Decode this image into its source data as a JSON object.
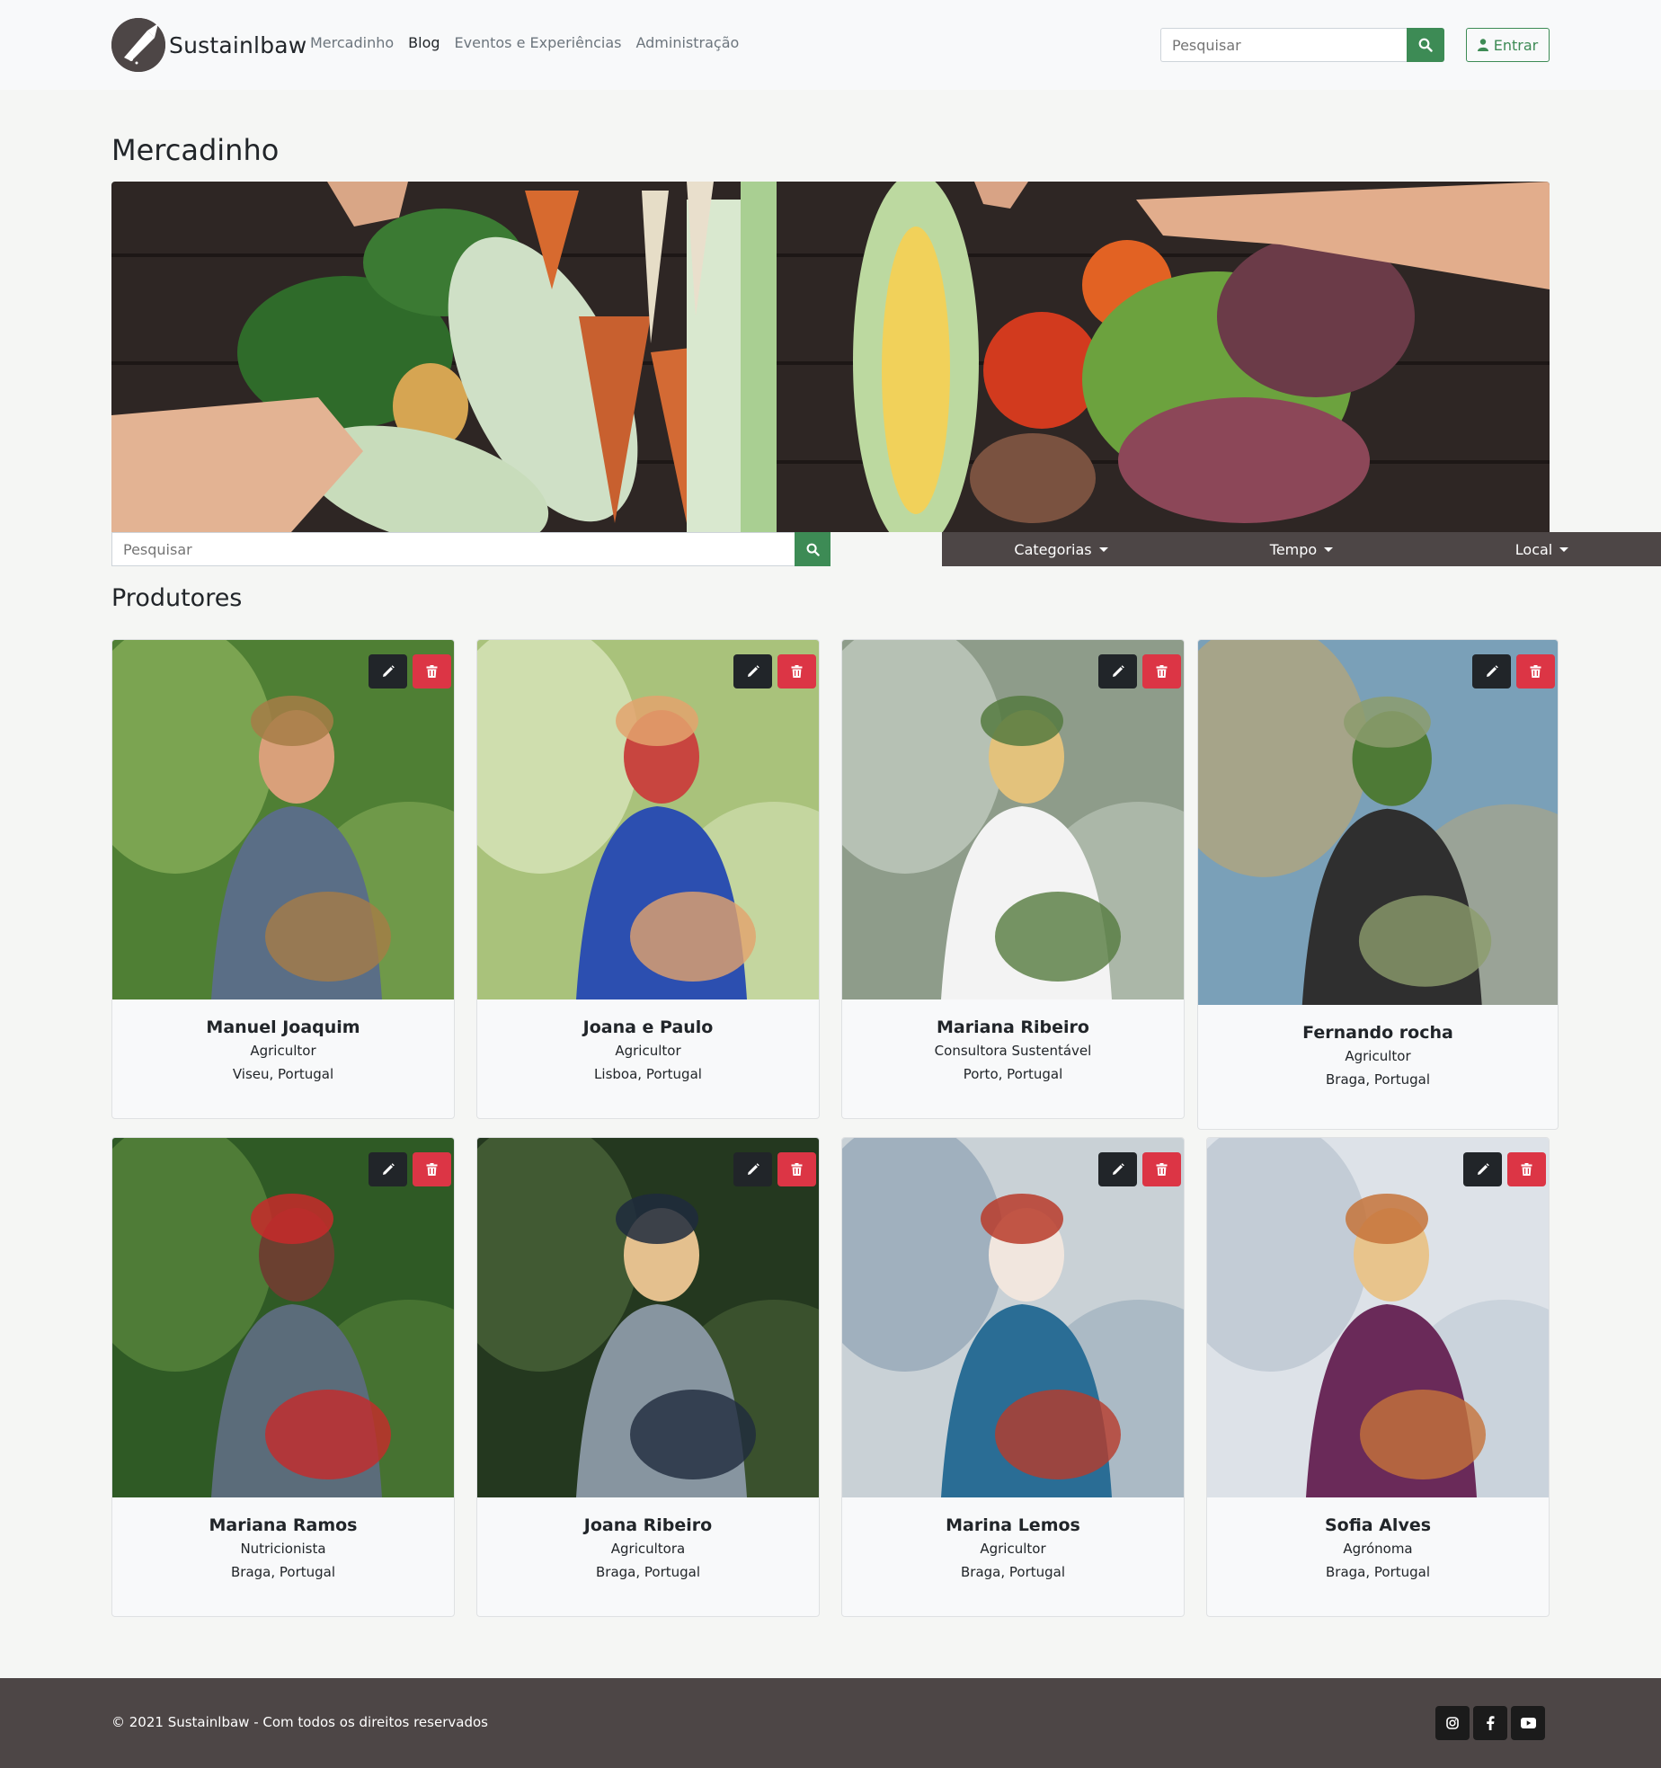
{
  "brand": {
    "name": "Sustainlbaw"
  },
  "nav": {
    "items": [
      {
        "label": "Mercadinho",
        "active": false
      },
      {
        "label": "Blog",
        "active": true
      },
      {
        "label": "Eventos e Experiências",
        "active": false
      },
      {
        "label": "Administração",
        "active": false
      }
    ],
    "search_placeholder": "Pesquisar",
    "login_label": "Entrar"
  },
  "page": {
    "title": "Mercadinho"
  },
  "filters": {
    "search_placeholder": "Pesquisar",
    "categories_label": "Categorias",
    "time_label": "Tempo",
    "location_label": "Local"
  },
  "producers": {
    "title": "Produtores",
    "items": [
      {
        "name": "Manuel Joaquim",
        "role": "Agricultor",
        "location": "Viseu, Portugal"
      },
      {
        "name": "Joana e Paulo",
        "role": "Agricultor",
        "location": "Lisboa, Portugal"
      },
      {
        "name": "Mariana Ribeiro",
        "role": "Consultora Sustentável",
        "location": "Porto, Portugal"
      },
      {
        "name": "Fernando rocha",
        "role": "Agricultor",
        "location": "Braga, Portugal"
      },
      {
        "name": "Mariana Ramos",
        "role": "Nutricionista",
        "location": "Braga, Portugal"
      },
      {
        "name": "Joana Ribeiro",
        "role": "Agricultora",
        "location": "Braga, Portugal"
      },
      {
        "name": "Marina Lemos",
        "role": "Agricultor",
        "location": "Braga, Portugal"
      },
      {
        "name": "Sofia Alves",
        "role": "Agrónoma",
        "location": "Braga, Portugal"
      }
    ]
  },
  "footer": {
    "copyright": "© 2021 Sustainlbaw - Com todos os direitos reservados"
  },
  "colors": {
    "accent": "#3d8b55",
    "dark": "#4d4646",
    "danger": "#dc3545"
  }
}
